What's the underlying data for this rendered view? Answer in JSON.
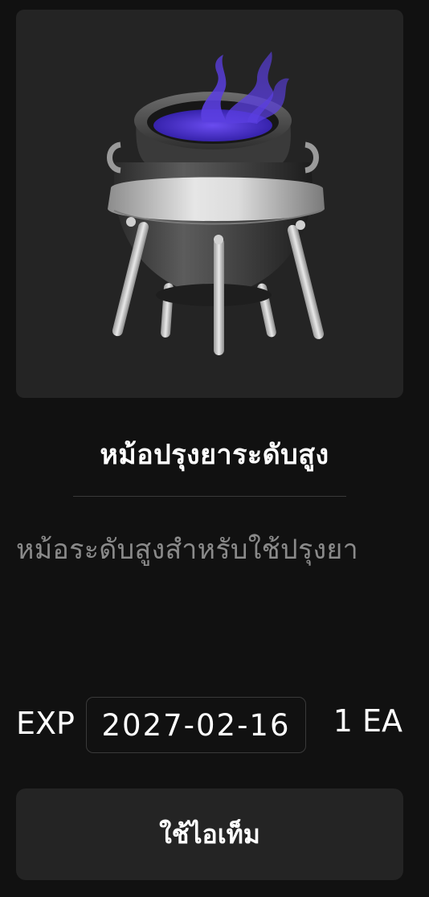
{
  "item": {
    "image_icon": "cauldron-icon",
    "title": "หม้อปรุงยาระดับสูง",
    "description": "หม้อระดับสูงสำหรับใช้ปรุงยา",
    "exp_label": "EXP",
    "exp_date": "2027-02-16",
    "quantity": "1 EA"
  },
  "actions": {
    "use_label": "ใช้ไอเท็ม"
  },
  "colors": {
    "background": "#111111",
    "card": "#242424",
    "potion": "#4b2fd6",
    "text_primary": "#ffffff",
    "text_secondary": "#8a8a8a"
  }
}
